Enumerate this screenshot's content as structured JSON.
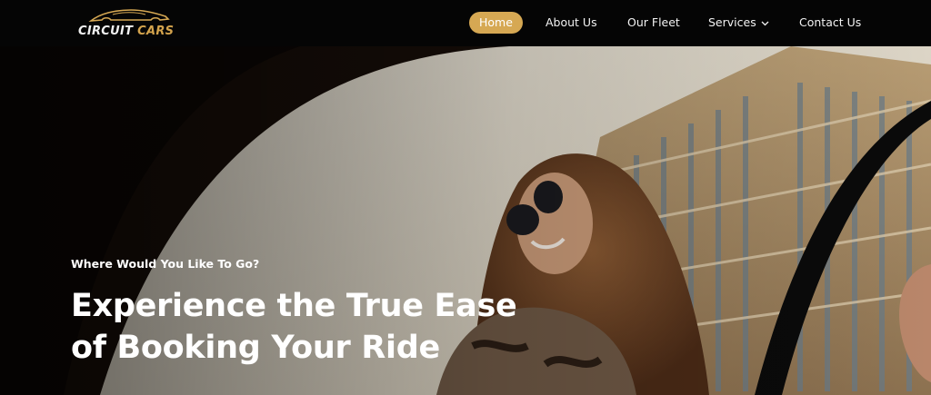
{
  "brand": {
    "name_primary": "CIRCUIT",
    "name_accent": "CARS",
    "accent_color": "#d6a853"
  },
  "nav": {
    "items": [
      {
        "label": "Home",
        "active": true
      },
      {
        "label": "About Us"
      },
      {
        "label": "Our Fleet"
      },
      {
        "label": "Services",
        "has_dropdown": true
      },
      {
        "label": "Contact Us"
      }
    ]
  },
  "hero": {
    "tagline": "Where Would You Like To Go?",
    "headline_line1": "Experience the True Ease",
    "headline_line2": "of Booking Your Ride"
  }
}
